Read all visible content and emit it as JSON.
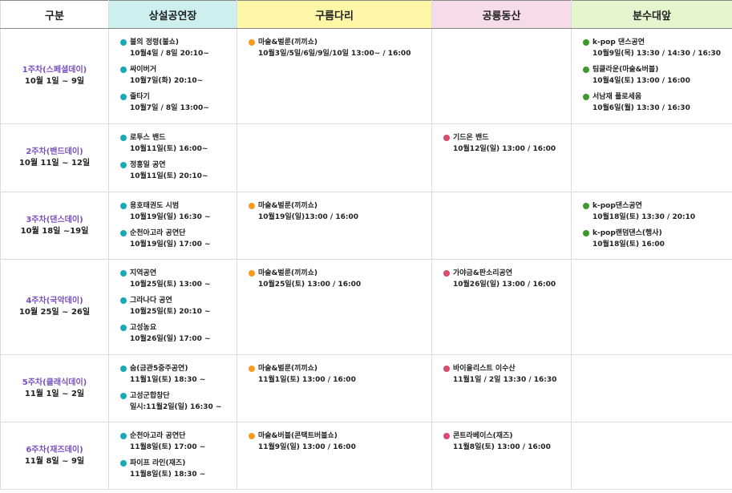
{
  "headers": [
    "구분",
    "상설공연장",
    "구름다리",
    "공룡동산",
    "분수대앞"
  ],
  "rows": [
    {
      "week_name": "1주차(스페셜데이)",
      "week_date": "10월 1일 ~ 9일",
      "cells": [
        [
          {
            "title": "불의 정령(불쇼)",
            "time": "10월4일 / 8일 20:10~"
          },
          {
            "title": "싸이버거",
            "time": "10월7일(화) 20:10~"
          },
          {
            "title": "줄타기",
            "time": "10월7일 / 8일 13:00~"
          }
        ],
        [
          {
            "title": "마술&벌룬(끼끼쇼)",
            "time": "10월3일/5일/6일/9일/10일 13:00~ / 16:00"
          }
        ],
        [],
        [
          {
            "title": "k-pop 댄스공연",
            "time": "10월9일(목) 13:30 / 14:30 / 16:30"
          },
          {
            "title": "팀클라운(마술&버블)",
            "time": "10월4일(토) 13:00 / 16:00"
          },
          {
            "title": "서남재 폴로세움",
            "time": "10월6일(월) 13:30 / 16:30"
          }
        ]
      ]
    },
    {
      "week_name": "2주차(밴드데이)",
      "week_date": "10월 11일 ~ 12일",
      "cells": [
        [
          {
            "title": "로투스 밴드",
            "time": "10월11일(토) 16:00~"
          },
          {
            "title": "정홍일 공연",
            "time": "10월11일(토) 20:10~"
          }
        ],
        [],
        [
          {
            "title": "기드온 밴드",
            "time": "10월12일(일) 13:00 / 16:00"
          }
        ],
        []
      ]
    },
    {
      "week_name": "3주차(댄스데이)",
      "week_date": "10월 18일 ~19일",
      "cells": [
        [
          {
            "title": "용호태권도 시범",
            "time": "10월19일(일) 16:30 ~"
          },
          {
            "title": "순천아고라 공연단",
            "time": "10월19일(일) 17:00 ~"
          }
        ],
        [
          {
            "title": "마술&벌룬(끼끼쇼)",
            "time": "10월19일(일)13:00 / 16:00"
          }
        ],
        [],
        [
          {
            "title": "k-pop댄스공연",
            "time": "10월18일(토) 13:30 / 20:10"
          },
          {
            "title": "k-pop랜덤댄스(행사)",
            "time": "10월18일(토) 16:00"
          }
        ]
      ]
    },
    {
      "week_name": "4주차(국악데이)",
      "week_date": "10월 25일 ~ 26일",
      "cells": [
        [
          {
            "title": "지역공연",
            "time": "10월25일(토) 13:00 ~"
          },
          {
            "title": "그라나다 공연",
            "time": "10월25일(토) 20:10 ~"
          },
          {
            "title": "고성농요",
            "time": "10월26일(일) 17:00 ~"
          }
        ],
        [
          {
            "title": "마술&벌룬(끼끼쇼)",
            "time": "10월25일(토) 13:00 / 16:00"
          }
        ],
        [
          {
            "title": "가야금&판소리공연",
            "time": "10월26일(일) 13:00 / 16:00"
          }
        ],
        []
      ]
    },
    {
      "week_name": "5주차(클래식데이)",
      "week_date": "11월 1일 ~ 2일",
      "cells": [
        [
          {
            "title": "숨(금관5중주공연)",
            "time": "11월1일(토) 18:30 ~"
          },
          {
            "title": "고성군합창단",
            "time": "일시:11월2일(일) 16:30 ~"
          }
        ],
        [
          {
            "title": "마술&벌룬(끼끼쇼)",
            "time": "11월1일(토) 13:00 / 16:00"
          }
        ],
        [
          {
            "title": "바이올리스트 이수산",
            "time": "11월1일 / 2일 13:30 / 16:30"
          }
        ],
        []
      ]
    },
    {
      "week_name": "6주차(재즈데이)",
      "week_date": "11월 8일 ~ 9일",
      "cells": [
        [
          {
            "title": "순천아고라 공연단",
            "time": "11월8일(토) 17:00 ~"
          },
          {
            "title": "파이프 라인(재즈)",
            "time": "11월8일(토) 18:30 ~"
          }
        ],
        [
          {
            "title": "마술&버블(콘택트버블쇼)",
            "time": "11월9일(일) 13:00 / 16:00"
          }
        ],
        [
          {
            "title": "콘트라베이스(재즈)",
            "time": "11월8일(토) 13:00 / 16:00"
          }
        ],
        []
      ]
    }
  ]
}
